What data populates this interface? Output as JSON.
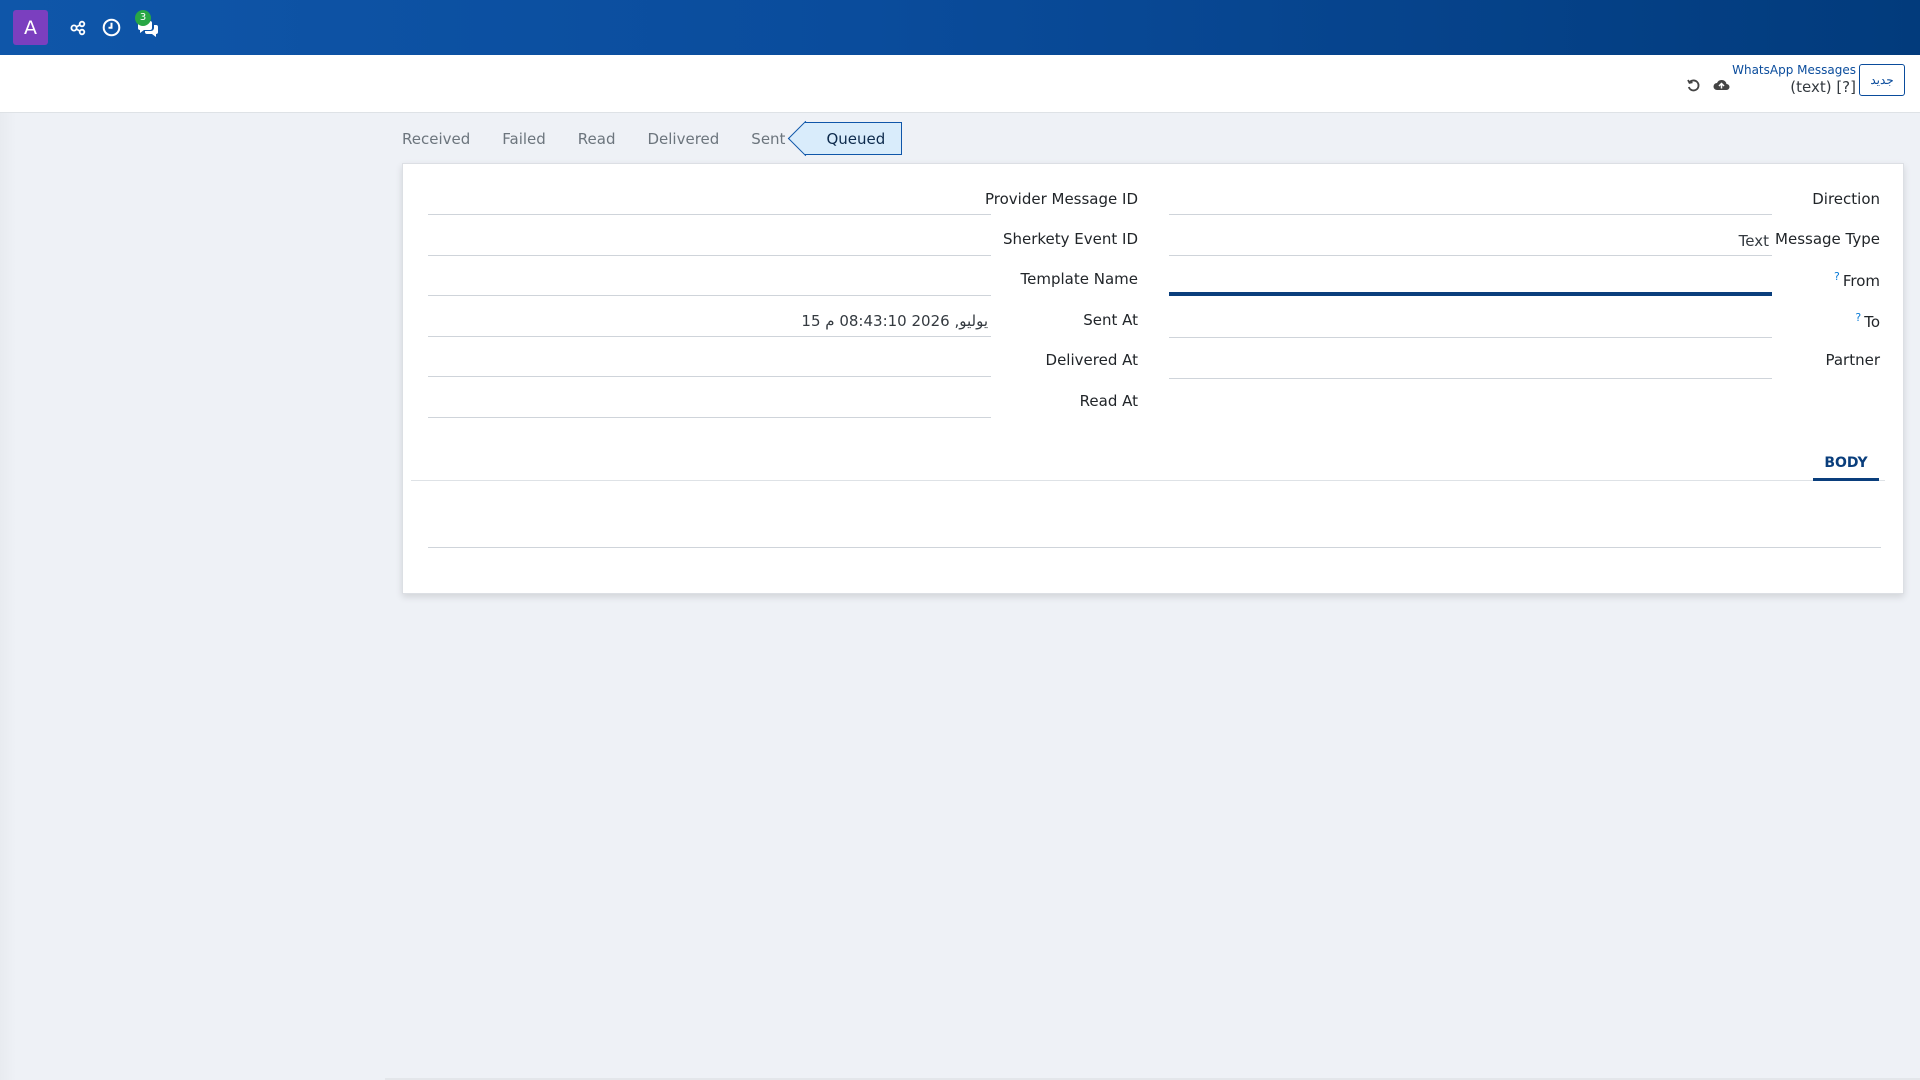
{
  "navbar": {
    "avatar_letter": "A",
    "icons": [
      "connections-icon",
      "clock-icon",
      "chat-icon"
    ],
    "chat_badge": "3",
    "colors": {
      "gradient_start": "#0f56a9",
      "gradient_end": "#023b7c",
      "avatar_bg": "#7b3fbf",
      "badge_bg": "#28a745"
    }
  },
  "control_panel": {
    "new_button": "جديد",
    "breadcrumb_parent": "WhatsApp Messages",
    "breadcrumb_current": "(text) [?]",
    "icons": [
      "discard-icon",
      "cloud-save-icon"
    ]
  },
  "statusbar": {
    "items": [
      "Received",
      "Failed",
      "Read",
      "Delivered",
      "Sent"
    ],
    "active": "Queued"
  },
  "form": {
    "right_column": {
      "direction_label": "Direction",
      "message_type_label": "Message Type",
      "message_type_value": "Text",
      "from_label": "From",
      "from_help": "?",
      "to_label": "To",
      "to_help": "?",
      "partner_label": "Partner"
    },
    "left_column": {
      "provider_message_id_label": "Provider Message ID",
      "sherkety_event_id_label": "Sherkety Event ID",
      "template_name_label": "Template Name",
      "sent_at_label": "Sent At",
      "sent_at_value": "15 يوليو, 2026 08:43:10 م",
      "delivered_at_label": "Delivered At",
      "read_at_label": "Read At"
    },
    "tabs": [
      "BODY"
    ]
  }
}
